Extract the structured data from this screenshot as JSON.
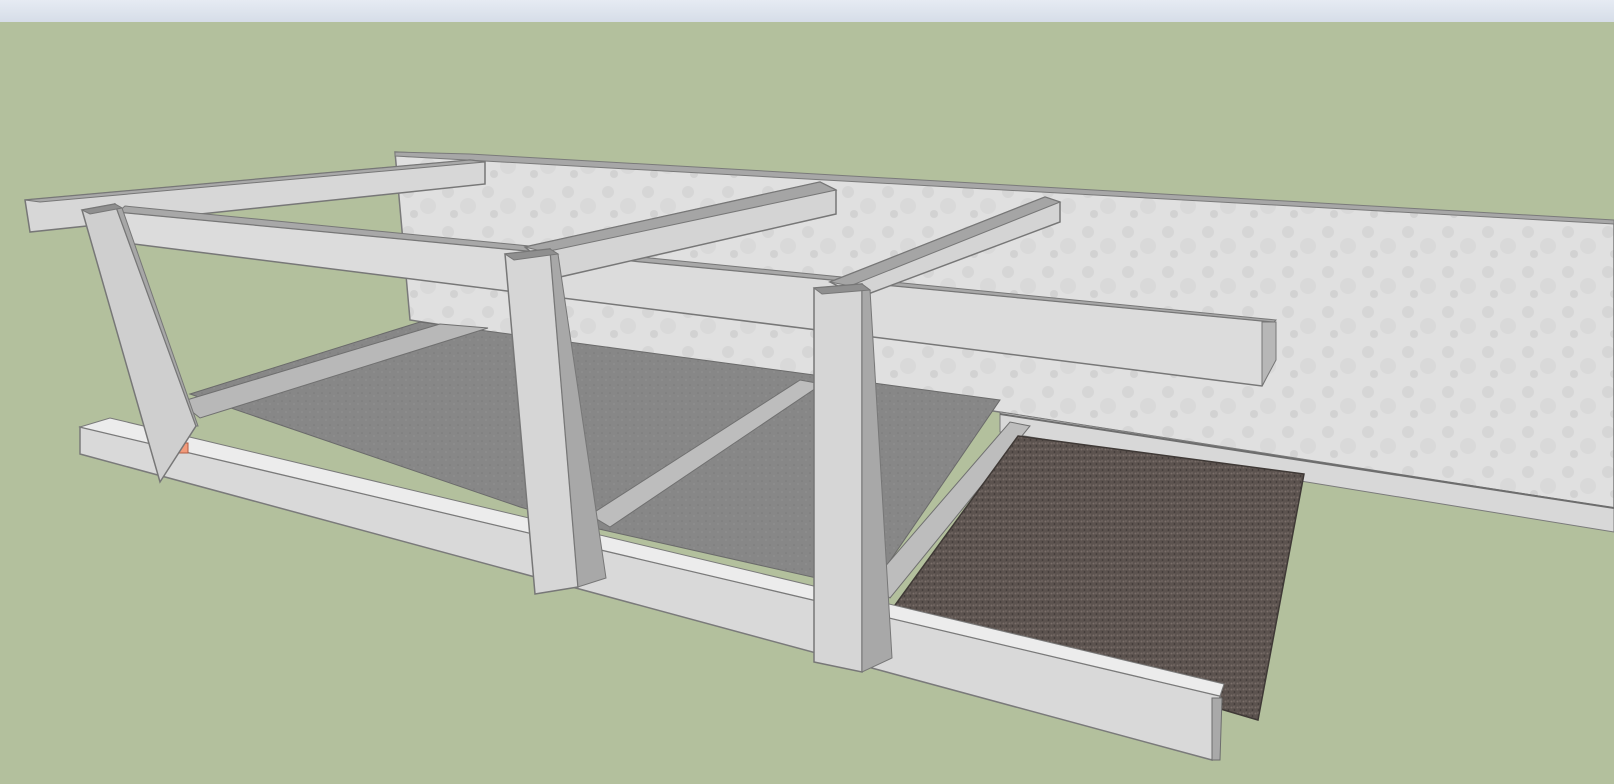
{
  "app": {
    "title": "",
    "top_bar_label": ""
  },
  "colors": {
    "sky": "#b3c09d",
    "ground": "#b3c09d",
    "concrete_light": "#e2e2e2",
    "concrete_mid": "#c9c9c9",
    "concrete_dark": "#9f9f9f",
    "floor": "#868686",
    "gravel": "#5e5450",
    "edge": "#6d6d6d",
    "marker": "#f29a7a"
  },
  "viewport": {
    "scene": "3d-model-structure",
    "label": ""
  }
}
